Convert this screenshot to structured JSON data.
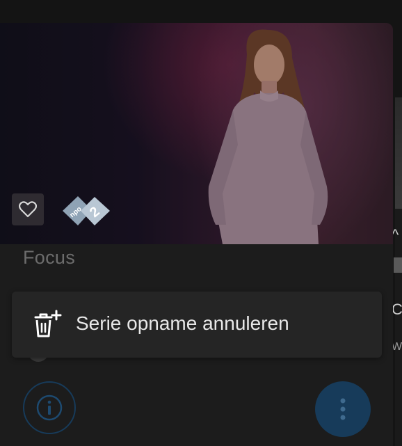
{
  "program": {
    "title": "Focus",
    "channel": "npo2"
  },
  "popup_menu": {
    "items": [
      {
        "label": "Serie opname annuleren",
        "icon": "trash-plus-icon"
      }
    ]
  },
  "next_card_peek": {
    "glyph_top": "^",
    "glyph_mid": "C",
    "glyph_bottom": "W"
  },
  "colors": {
    "accent": "#173b5a",
    "background": "#141414",
    "card": "#1c1c1c",
    "popup": "#252525",
    "text_primary": "#e8e8e8",
    "text_muted": "#6c6c6c"
  }
}
